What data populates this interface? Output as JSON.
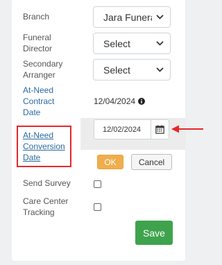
{
  "form": {
    "branch": {
      "label": "Branch",
      "value": "Jara Funera"
    },
    "funeral_director": {
      "label_1": "Funeral",
      "label_2": "Director",
      "value": "Select"
    },
    "secondary_arranger": {
      "label_1": "Secondary",
      "label_2": "Arranger",
      "value": "Select"
    },
    "contract_date": {
      "label_1": "At-Need",
      "label_2": "Contract",
      "label_3": "Date",
      "value": "12/04/2024",
      "icon": "info-circle-icon"
    },
    "conversion_date": {
      "label_1": "At-Need",
      "label_2": "Conversion",
      "label_3": "Date",
      "value": "12/02/2024",
      "icon": "calendar-icon"
    },
    "ok_label": "OK",
    "cancel_label": "Cancel",
    "send_survey": {
      "label": "Send Survey",
      "checked": false
    },
    "care_center": {
      "label_1": "Care Center",
      "label_2": "Tracking",
      "checked": false
    },
    "save_label": "Save"
  },
  "colors": {
    "accent_link": "#2c6aa0",
    "ok": "#f0ad4e",
    "save": "#3fa34d",
    "annotation": "#e8262a"
  }
}
